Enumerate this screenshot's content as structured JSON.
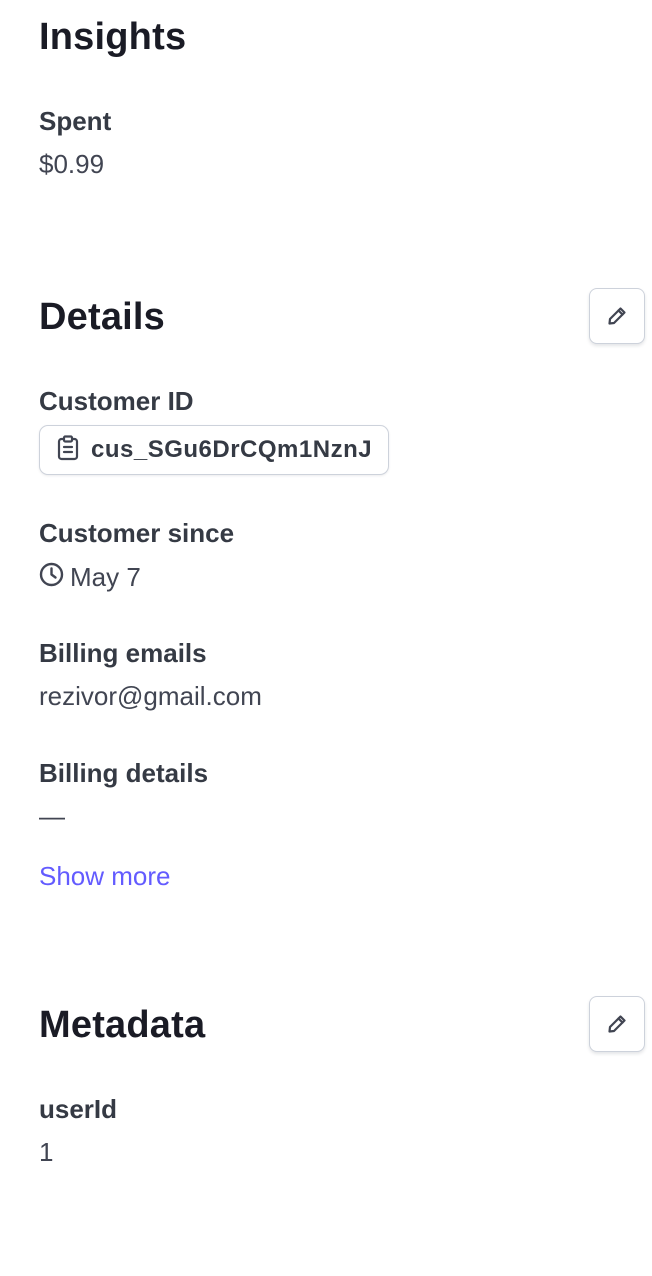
{
  "insights": {
    "title": "Insights",
    "spent_label": "Spent",
    "spent_value": "$0.99"
  },
  "details": {
    "title": "Details",
    "customer_id_label": "Customer ID",
    "customer_id_value": "cus_SGu6DrCQm1NznJ",
    "customer_since_label": "Customer since",
    "customer_since_value": "May 7",
    "billing_emails_label": "Billing emails",
    "billing_emails_value": "rezivor@gmail.com",
    "billing_details_label": "Billing details",
    "billing_details_value": "—",
    "show_more": "Show more"
  },
  "metadata": {
    "title": "Metadata",
    "key": "userId",
    "value": "1"
  },
  "icons": {
    "edit": "pencil-icon",
    "copy": "clipboard-icon",
    "time": "clock-icon"
  },
  "colors": {
    "heading": "#1a1b25",
    "text": "#353a44",
    "link": "#635bff",
    "border": "#cdd2db"
  }
}
